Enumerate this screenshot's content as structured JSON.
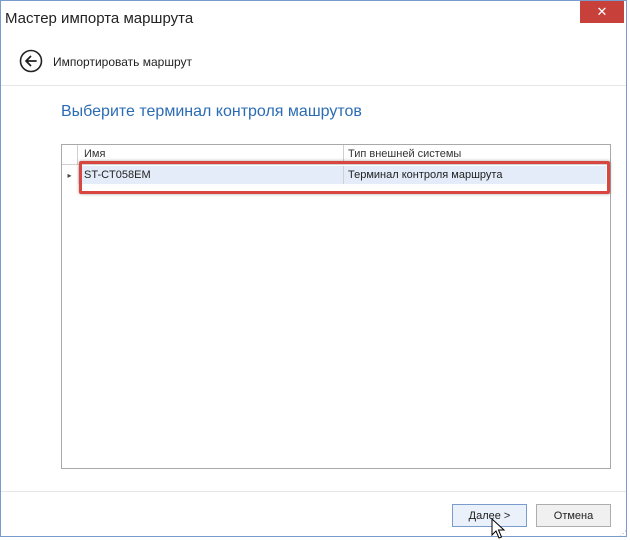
{
  "window": {
    "title": "Мастер импорта маршрута",
    "close_label": "✕"
  },
  "nav": {
    "back_icon": "arrow-left-circle-icon",
    "title": "Импортировать маршрут"
  },
  "page": {
    "heading": "Выберите терминал контроля машрутов"
  },
  "grid": {
    "columns": [
      "Имя",
      "Тип внешней системы"
    ],
    "rows": [
      {
        "indicator": "▸",
        "name": "ST-CT058EM",
        "type": "Терминал контроля маршрута"
      }
    ]
  },
  "footer": {
    "next_label": "Далее >",
    "cancel_label": "Отмена"
  },
  "colors": {
    "accent": "#2b6cb4",
    "close": "#c7403a",
    "highlight": "#d9453f",
    "selection": "#e3ecf8"
  }
}
